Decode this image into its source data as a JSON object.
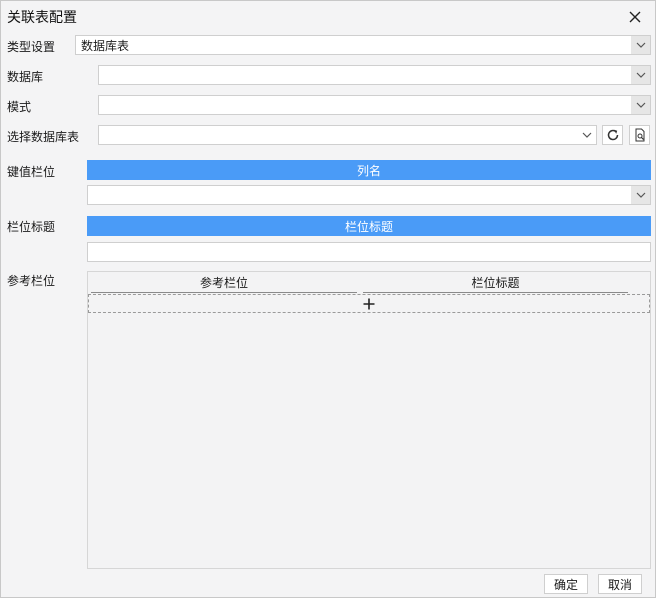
{
  "dialog": {
    "title": "关联表配置"
  },
  "form": {
    "type_label": "类型设置",
    "type_value": "数据库表",
    "database_label": "数据库",
    "database_value": "",
    "schema_label": "模式",
    "schema_value": "",
    "table_label": "选择数据库表",
    "table_value": "",
    "key_label": "键值栏位",
    "key_header": "列名",
    "key_value": "",
    "title_label": "栏位标题",
    "title_header": "栏位标题",
    "title_value": "",
    "ref_label": "参考栏位"
  },
  "ref_table": {
    "columns": [
      "参考栏位",
      "栏位标题"
    ],
    "add_symbol": "+"
  },
  "footer": {
    "ok_label": "确定",
    "cancel_label": "取消"
  },
  "icons": {
    "close": "close-icon",
    "dropdown": "chevron-down-icon",
    "refresh": "refresh-icon",
    "preview": "document-search-icon"
  }
}
